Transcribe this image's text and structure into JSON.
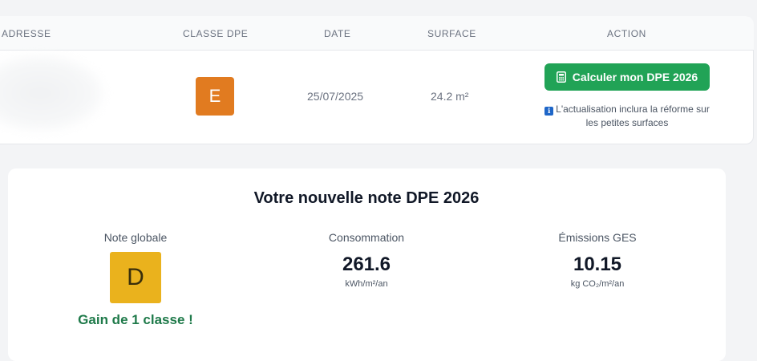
{
  "table": {
    "headers": {
      "adresse": "ADRESSE",
      "classe_dpe": "CLASSE DPE",
      "date": "DATE",
      "surface": "SURFACE",
      "action": "ACTION"
    },
    "row": {
      "classe": "E",
      "classe_color": "#e17b20",
      "date": "25/07/2025",
      "surface": "24.2 m²",
      "action_button": "Calculer mon DPE 2026",
      "info_icon": "ℹ",
      "info_text": "L'actualisation inclura la réforme sur les petites surfaces"
    }
  },
  "result": {
    "title": "Votre nouvelle note DPE 2026",
    "note_globale": {
      "label": "Note globale",
      "classe": "D",
      "color": "#eab21d"
    },
    "gain": "Gain de 1 classe !",
    "consommation": {
      "label": "Consommation",
      "value": "261.6",
      "unit": "kWh/m²/an"
    },
    "emissions": {
      "label": "Émissions GES",
      "value": "10.15",
      "unit": "kg CO₂/m²/an"
    }
  },
  "colors": {
    "accent_green": "#21a356",
    "gain_green": "#1f7a4a"
  }
}
